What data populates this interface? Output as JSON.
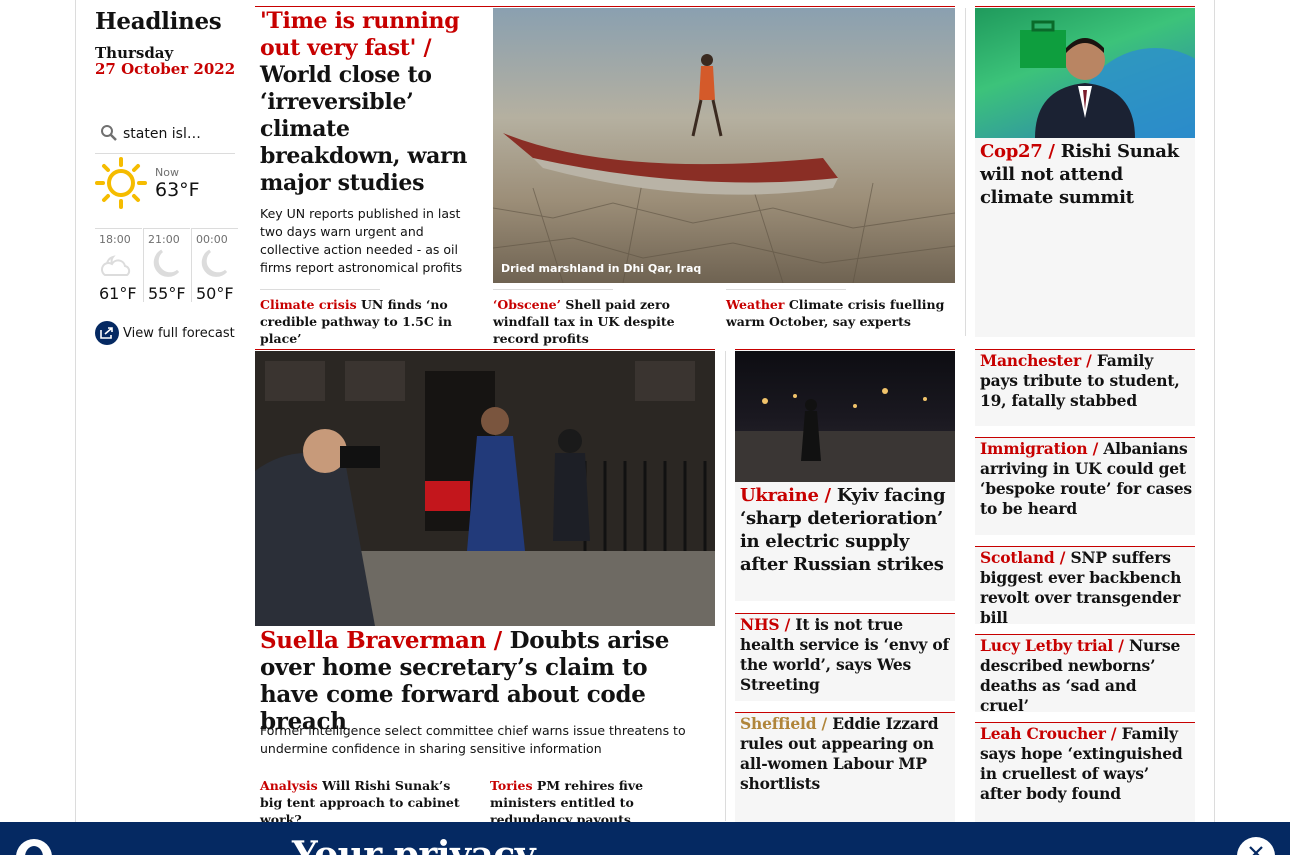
{
  "sidebar": {
    "heading": "Headlines",
    "day": "Thursday",
    "date": "27 October 2022",
    "location": "staten isl…",
    "now_label": "Now",
    "now_temp": "63°F",
    "forecast": [
      {
        "time": "18:00",
        "temp": "61°F",
        "icon": "partly-cloudy-night-icon"
      },
      {
        "time": "21:00",
        "temp": "55°F",
        "icon": "moon-icon"
      },
      {
        "time": "00:00",
        "temp": "50°F",
        "icon": "moon-icon"
      }
    ],
    "full_forecast": "View full forecast"
  },
  "lead": {
    "kicker": "'Time is running out very fast' /",
    "headline": "World close to ‘irreversible’ climate breakdown, warn major studies",
    "standfirst": "Key UN reports published in last two days warn urgent and collective action needed - as oil firms report astronomical profits",
    "caption": "Dried marshland in Dhi Qar, Iraq",
    "subs": [
      {
        "kicker": "Climate crisis",
        "text": "UN finds ‘no credible pathway to 1.5C in place’"
      },
      {
        "kicker": "‘Obscene’",
        "text": "Shell paid zero windfall tax in UK despite record profits"
      },
      {
        "kicker": "Weather",
        "text": "Climate crisis fuelling warm October, say experts"
      }
    ]
  },
  "cop27": {
    "kicker": "Cop27 /",
    "headline": "Rishi Sunak will not attend climate summit"
  },
  "braverman": {
    "kicker": "Suella Braverman /",
    "headline": "Doubts arise over home secretary’s claim to have come forward about code breach",
    "standfirst": "Former intelligence select committee chief warns issue threatens to undermine confidence in sharing sensitive information",
    "subs": [
      {
        "kicker": "Analysis",
        "text": "Will Rishi Sunak’s big tent approach to cabinet work?"
      },
      {
        "kicker": "Tories",
        "text": "PM rehires five ministers entitled to redundancy payouts"
      }
    ]
  },
  "middle": [
    {
      "kicker": "Ukraine /",
      "text": "Kyiv facing ‘sharp deterioration’ in electric supply after Russian strikes"
    },
    {
      "kicker": "NHS /",
      "text": "It is not true health service is ‘envy of the world’, says Wes Streeting"
    },
    {
      "kicker": "Sheffield /",
      "text": "Eddie Izzard rules out appearing on all-women Labour MP shortlists"
    }
  ],
  "right": [
    {
      "kicker": "Manchester /",
      "text": "Family pays tribute to student, 19, fatally stabbed"
    },
    {
      "kicker": "Immigration /",
      "text": "Albanians arriving in UK could get ‘bespoke route’ for cases to be heard"
    },
    {
      "kicker": "Scotland /",
      "text": "SNP suffers biggest ever backbench revolt over transgender bill"
    },
    {
      "kicker": "Lucy Letby trial /",
      "text": "Nurse described newborns’ deaths as ‘sad and cruel’"
    },
    {
      "kicker": "Leah Croucher /",
      "text": "Family says hope ‘extinguished in cruellest of ways’ after body found"
    }
  ],
  "banner": {
    "title": "Your privacy"
  },
  "colors": {
    "news_red": "#c70000",
    "brand_blue": "#052962",
    "sheffield_kicker": "#b0853a"
  }
}
